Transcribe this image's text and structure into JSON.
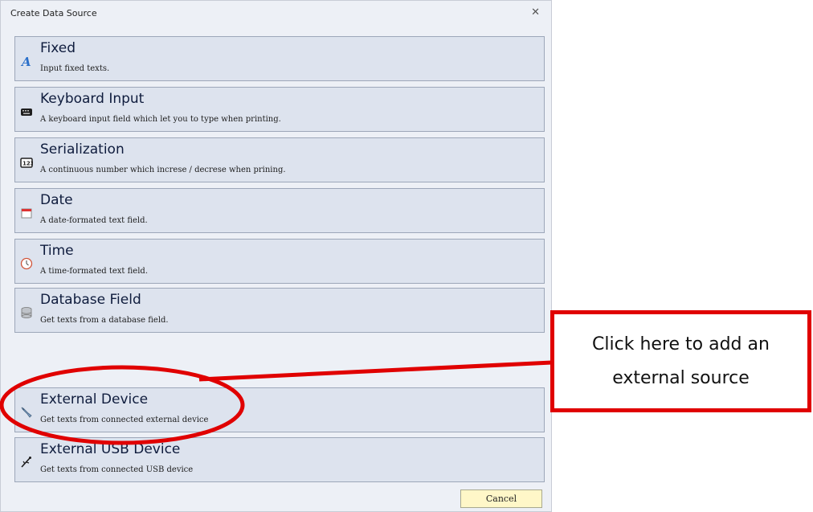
{
  "dialog": {
    "title": "Create Data Source",
    "close_symbol": "✕"
  },
  "options": [
    {
      "title": "Fixed",
      "description": "Input fixed texts.",
      "icon": "letter-a-icon"
    },
    {
      "title": "Keyboard Input",
      "description": "A keyboard input field which let you to type when printing.",
      "icon": "keyboard-icon"
    },
    {
      "title": "Serialization",
      "description": "A continuous number which increse / decrese when prining.",
      "icon": "serial-number-icon"
    },
    {
      "title": "Date",
      "description": "A date-formated text field.",
      "icon": "calendar-icon"
    },
    {
      "title": "Time",
      "description": "A time-formated text field.",
      "icon": "clock-icon"
    },
    {
      "title": "Database Field",
      "description": "Get texts from a database field.",
      "icon": "database-icon"
    },
    {
      "title": "External Device",
      "description": "Get texts from connected external device",
      "icon": "external-device-icon"
    },
    {
      "title": "External USB Device",
      "description": "Get texts from connected USB device",
      "icon": "usb-icon"
    }
  ],
  "cancel_label": "Cancel",
  "annotation": {
    "line1": "Click here to add an",
    "line2": "external source",
    "color": "#e00000"
  }
}
